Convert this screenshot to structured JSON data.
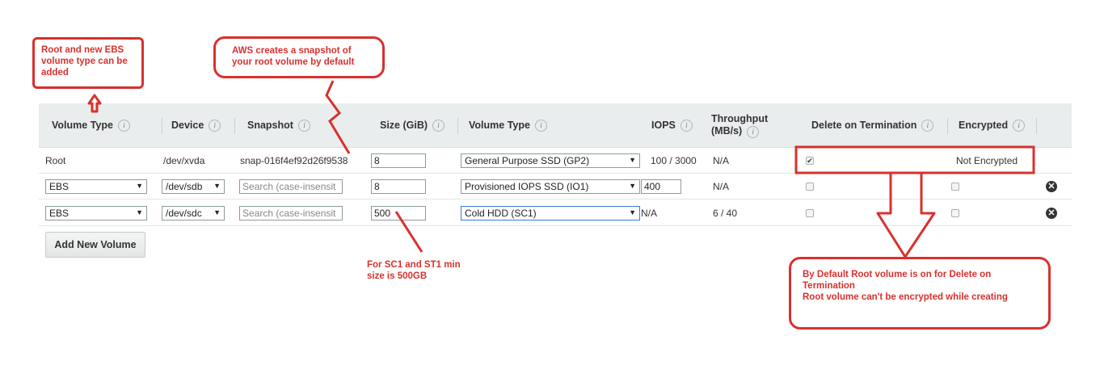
{
  "columns": [
    {
      "label": "Volume Type",
      "info": "i"
    },
    {
      "label": "Device",
      "info": "i"
    },
    {
      "label": "Snapshot",
      "info": "i"
    },
    {
      "label": "Size (GiB)",
      "info": "i"
    },
    {
      "label": "Volume Type",
      "info": "i"
    },
    {
      "label": "IOPS",
      "info": "i"
    },
    {
      "label": "Throughput",
      "label2": "(MB/s)",
      "info": "i"
    },
    {
      "label": "Delete on Termination",
      "info": "i"
    },
    {
      "label": "Encrypted",
      "info": "i"
    }
  ],
  "rows": [
    {
      "volume_type": "Root",
      "device": "/dev/xvda",
      "snapshot": "snap-016f4ef92d26f9538",
      "size": "8",
      "type_select": "General Purpose SSD (GP2)",
      "iops": "100 / 3000",
      "throughput": "N/A",
      "delete_on_termination": true,
      "encrypted": "Not Encrypted"
    },
    {
      "volume_type": "EBS",
      "device": "/dev/sdb",
      "snapshot_placeholder": "Search (case-insensit",
      "size": "8",
      "type_select": "Provisioned IOPS SSD (IO1)",
      "iops": "400",
      "throughput": "N/A",
      "delete_on_termination": false,
      "encrypted": false
    },
    {
      "volume_type": "EBS",
      "device": "/dev/sdc",
      "snapshot_placeholder": "Search (case-insensit",
      "size": "500",
      "type_select": "Cold HDD (SC1)",
      "iops": "N/A",
      "throughput": "6 / 40",
      "delete_on_termination": false,
      "encrypted": false
    }
  ],
  "add_button": "Add New Volume",
  "icons": {
    "dropdown": "▼",
    "remove": "✕",
    "check": "✔"
  },
  "annotations": {
    "root_ebs": [
      "Root and new EBS",
      "volume type can be",
      "added"
    ],
    "snapshot": [
      "AWS creates a snapshot of",
      "your root volume by default"
    ],
    "sc1": [
      "For SC1 and ST1 min",
      "size is 500GB"
    ],
    "default_root": [
      "By Default Root volume is on for Delete on",
      "Termination",
      "Root volume can't be encrypted while creating"
    ]
  },
  "colors": {
    "annotation": "#d8312d",
    "header_bg": "#eaeded",
    "accent_select": "#3a7bd5"
  }
}
